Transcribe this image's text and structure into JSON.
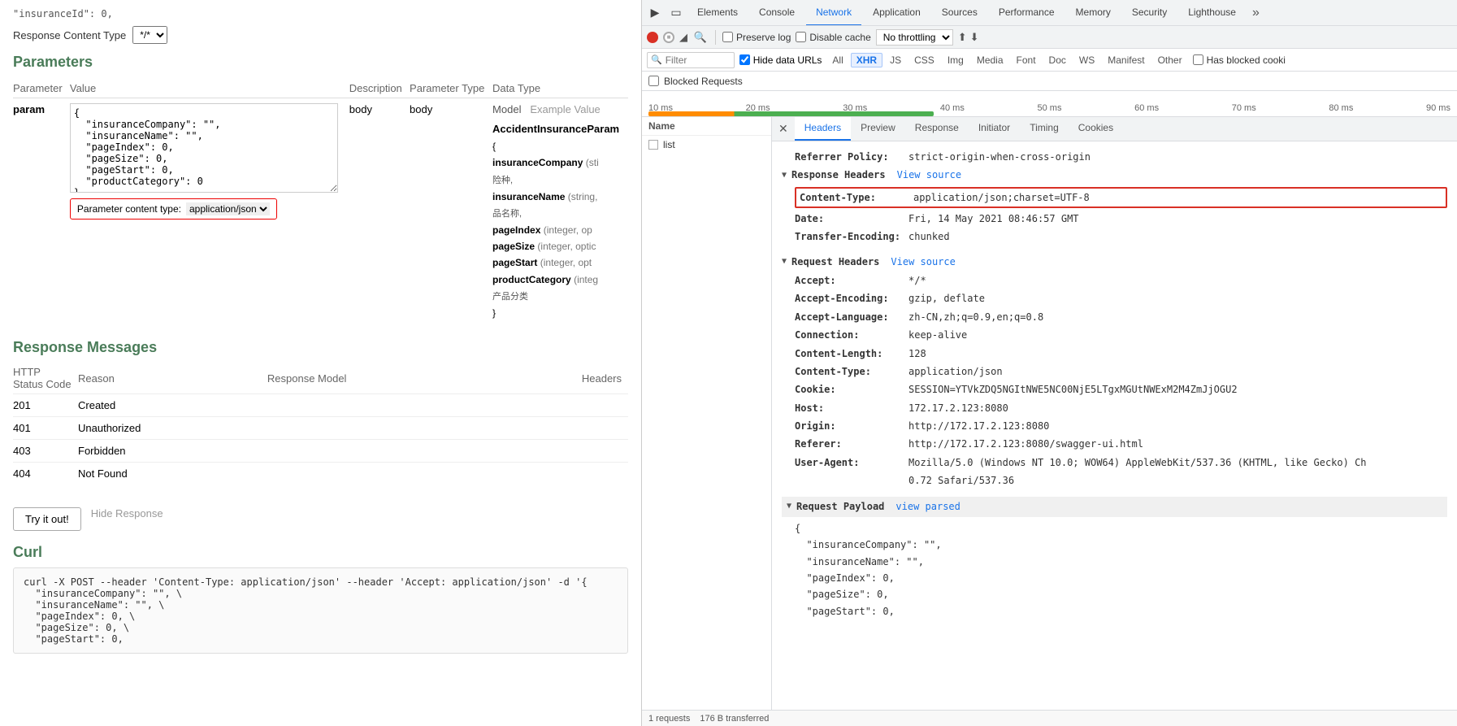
{
  "left": {
    "top_code": "\"insuranceId\": 0,",
    "response_content_type_label": "Response Content Type",
    "response_content_type_value": "*/*",
    "parameters_title": "Parameters",
    "param_col_headers": {
      "parameter": "Parameter",
      "value": "Value",
      "description": "Description",
      "parameter_type": "Parameter Type",
      "data_type": "Data Type"
    },
    "param_name": "param",
    "param_textarea": "{\n  \"insuranceCompany\": \"\",\n  \"insuranceName\": \"\",\n  \"pageIndex\": 0,\n  \"pageSize\": 0,\n  \"pageStart\": 0,\n  \"productCategory\": 0\n}",
    "param_type": "body",
    "param_content_label": "Parameter content type:",
    "param_content_value": "application/json",
    "model_tab": "Model",
    "example_tab": "Example Value",
    "model_class": "AccidentInsuranceParam",
    "model_fields": [
      {
        "name": "insuranceCompany",
        "meta": "(sti",
        "desc": "险种,"
      },
      {
        "name": "insuranceName",
        "meta": "(string,",
        "desc": "品名称,"
      },
      {
        "name": "pageIndex",
        "meta": "(integer, op",
        "desc": ""
      },
      {
        "name": "pageSize",
        "meta": "(integer, optic",
        "desc": ""
      },
      {
        "name": "pageStart",
        "meta": "(integer, opt",
        "desc": ""
      },
      {
        "name": "productCategory",
        "meta": "(integ",
        "desc": "产品分类"
      }
    ],
    "response_messages_title": "Response Messages",
    "resp_col_headers": {
      "http_status": "HTTP Status Code",
      "reason": "Reason",
      "response_model": "Response Model",
      "headers": "Headers"
    },
    "resp_rows": [
      {
        "code": "201",
        "reason": "Created",
        "model": "",
        "headers": ""
      },
      {
        "code": "401",
        "reason": "Unauthorized",
        "model": "",
        "headers": ""
      },
      {
        "code": "403",
        "reason": "Forbidden",
        "model": "",
        "headers": ""
      },
      {
        "code": "404",
        "reason": "Not Found",
        "model": "",
        "headers": ""
      }
    ],
    "try_it_btn": "Try it out!",
    "hide_response_link": "Hide Response",
    "curl_title": "Curl",
    "curl_content": "curl -X POST --header 'Content-Type: application/json' --header 'Accept: application/json' -d '{\n  \"insuranceCompany\": \"\", \\\n  \"insuranceName\": \"\", \\\n  \"pageIndex\": 0, \\\n  \"pageSize\": 0, \\\n  \"pageStart\": 0,"
  },
  "devtools": {
    "tabs": [
      {
        "label": "Elements",
        "active": false
      },
      {
        "label": "Console",
        "active": false
      },
      {
        "label": "Network",
        "active": true
      },
      {
        "label": "Application",
        "active": false
      },
      {
        "label": "Sources",
        "active": false
      },
      {
        "label": "Performance",
        "active": false
      },
      {
        "label": "Memory",
        "active": false
      },
      {
        "label": "Security",
        "active": false
      },
      {
        "label": "Lighthouse",
        "active": false
      }
    ],
    "toolbar": {
      "preserve_log_label": "Preserve log",
      "disable_cache_label": "Disable cache",
      "throttle_value": "No throttling"
    },
    "filter": {
      "placeholder": "Filter",
      "hide_data_urls": "Hide data URLs",
      "all_label": "All",
      "xhr_label": "XHR",
      "js_label": "JS",
      "css_label": "CSS",
      "img_label": "Img",
      "media_label": "Media",
      "font_label": "Font",
      "doc_label": "Doc",
      "ws_label": "WS",
      "manifest_label": "Manifest",
      "other_label": "Other",
      "has_blocked_label": "Has blocked cooki"
    },
    "blocked_requests_label": "Blocked Requests",
    "timeline": {
      "labels": [
        "10 ms",
        "20 ms",
        "30 ms",
        "40 ms",
        "50 ms",
        "60 ms",
        "70 ms",
        "80 ms",
        "90 ms"
      ]
    },
    "name_list": {
      "header": "Name",
      "items": [
        {
          "text": "list",
          "checked": false
        }
      ]
    },
    "detail": {
      "tabs": [
        "Headers",
        "Preview",
        "Response",
        "Initiator",
        "Timing",
        "Cookies"
      ],
      "active_tab": "Headers",
      "referrer_policy": {
        "key": "Referrer Policy:",
        "value": "strict-origin-when-cross-origin"
      },
      "response_headers_section": "Response Headers",
      "view_source_link": "View source",
      "content_type_highlighted": {
        "key": "Content-Type:",
        "value": "application/json;charset=UTF-8"
      },
      "date": {
        "key": "Date:",
        "value": "Fri, 14 May 2021 08:46:57 GMT"
      },
      "transfer_encoding": {
        "key": "Transfer-Encoding:",
        "value": "chunked"
      },
      "request_headers_section": "Request Headers",
      "view_source_link2": "View source",
      "request_headers": [
        {
          "key": "Accept:",
          "value": "*/*"
        },
        {
          "key": "Accept-Encoding:",
          "value": "gzip, deflate"
        },
        {
          "key": "Accept-Language:",
          "value": "zh-CN,zh;q=0.9,en;q=0.8"
        },
        {
          "key": "Connection:",
          "value": "keep-alive"
        },
        {
          "key": "Content-Length:",
          "value": "128"
        },
        {
          "key": "Content-Type:",
          "value": "application/json"
        },
        {
          "key": "Cookie:",
          "value": "SESSION=YTVkZDQ5NGItNWE5NC00NjE5LTgxMGUtNWExM2M4ZmJjOGU2"
        },
        {
          "key": "Host:",
          "value": "172.17.2.123:8080"
        },
        {
          "key": "Origin:",
          "value": "http://172.17.2.123:8080"
        },
        {
          "key": "Referer:",
          "value": "http://172.17.2.123:8080/swagger-ui.html"
        },
        {
          "key": "User-Agent:",
          "value": "Mozilla/5.0 (Windows NT 10.0; WOW64) AppleWebKit/537.36 (KHTML, like Gecko) Ch"
        },
        {
          "key": "",
          "value": "0.72 Safari/537.36"
        }
      ],
      "request_payload_section": "Request Payload",
      "view_parsed_link": "view parsed",
      "payload_json": "{\n  \"insuranceCompany\": \"\",\n  \"insuranceName\": \"\",\n  \"pageIndex\": 0,\n  \"pageSize\": 0,\n  \"pageStart\": 0,"
    },
    "bottom_status": {
      "requests": "1 requests",
      "transferred": "176 B transferred"
    }
  }
}
